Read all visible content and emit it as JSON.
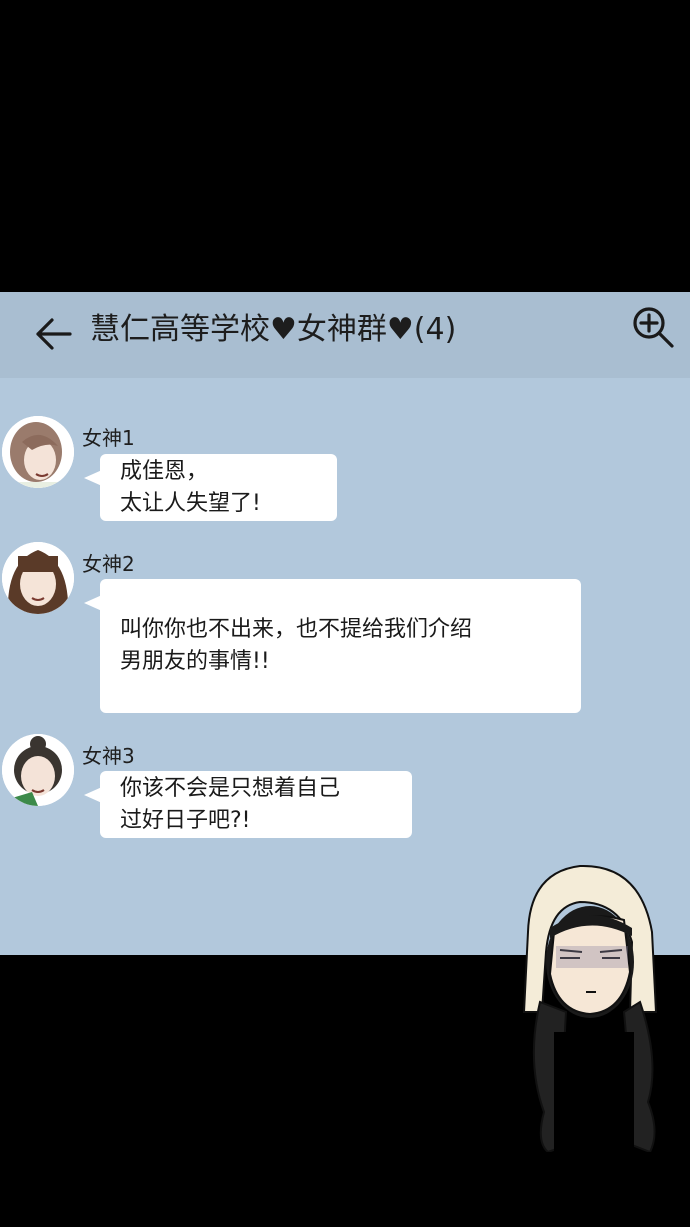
{
  "header": {
    "title": "慧仁高等学校♥女神群♥(4)",
    "back_icon": "arrow-left-icon",
    "zoom_icon": "zoom-in-icon"
  },
  "messages": [
    {
      "sender": "女神1",
      "lines": [
        "成佳恩，",
        "太让人失望了!"
      ]
    },
    {
      "sender": "女神2",
      "lines": [
        "叫你你也不出来，也不提给我们介绍",
        "男朋友的事情!!"
      ]
    },
    {
      "sender": "女神3",
      "lines": [
        "你该不会是只想着自己",
        "过好日子吧?!"
      ]
    }
  ],
  "colors": {
    "background": "#000000",
    "chat_bg": "#b2c8dc",
    "header_bg": "#a9bed1",
    "bubble": "#ffffff"
  }
}
